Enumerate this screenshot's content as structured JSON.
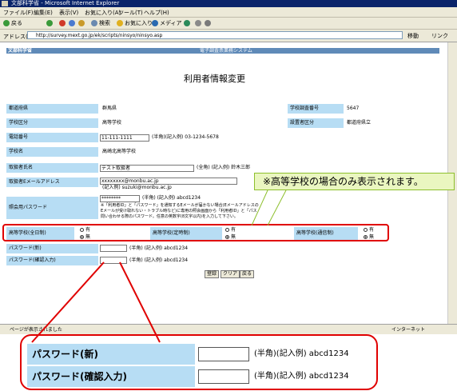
{
  "window": {
    "title": "文部科学省 - Microsoft Internet Explorer"
  },
  "menu": [
    "ファイル(F)",
    "編集(E)",
    "表示(V)",
    "お気に入り(A)",
    "ツール(T)",
    "ヘルプ(H)"
  ],
  "toolbar": {
    "back": "戻る",
    "search": "検索",
    "favorites": "お気に入り",
    "media": "メディア"
  },
  "address": {
    "label": "アドレス(D)",
    "url": "http://survey.mext.go.jp/ek/scripts/ninsyo/ninsyo.asp",
    "go": "移動",
    "links": "リンク"
  },
  "header": {
    "ministry": "文部科学省",
    "system": "電子調査票業務システム"
  },
  "page_title": "利用者情報変更",
  "form": {
    "pref_label": "都道府県",
    "pref_value": "群馬県",
    "school_no_label": "学校調査番号",
    "school_no_value": "5647",
    "school_type_label": "学校区分",
    "school_type_value": "高等学校",
    "founder_label": "設置者区分",
    "founder_value": "都道府県立",
    "phone_label": "電話番号",
    "phone_value": "11-111-1111",
    "phone_hint": "(半角)(記入例) 03-1234-5678",
    "school_name_label": "学校名",
    "school_name_value": "高崎北高等学校",
    "person_label": "取扱者氏名",
    "person_value": "テスト取扱者",
    "person_hint": "(全角) (記入例) 鈴木三郎",
    "email_label": "取扱者Eメールアドレス",
    "email_value": "xxxxxxxx@monbu.ac.jp",
    "email_hint": "(記入例) suzuki@monbu.ac.jp",
    "pw_label": "照会用パスワード",
    "pw_value": "********",
    "pw_hint": "(半角) (記入例) abcd1234",
    "pw_note1": "※「利用者ID」と「パスワード」を通知するEメールが届かない場合(Eメールアドレスの",
    "pw_note2": "Eメールが受け取れない・トラブル時など)に専用の照会画面から「利用者ID」と「パス",
    "pw_note3": "問い合わせる際のパスワード。任意の英数字(8文字以内)を入力して下さい。",
    "hs_full_label": "高等学校(全日制)",
    "hs_part_label": "高等学校(定時制)",
    "hs_corr_label": "高等学校(通信制)",
    "opt_yes": "有",
    "opt_no": "無",
    "newpw_label": "パスワード(新)",
    "newpw_hint": "(半角) (記入例) abcd1234",
    "confirmpw_label": "パスワード(確認入力)",
    "confirmpw_hint": "(半角) (記入例) abcd1234"
  },
  "buttons": {
    "register": "登録",
    "clear": "クリア",
    "back": "戻る"
  },
  "callout": "※高等学校の場合のみ表示されます。",
  "status": {
    "left": "ページが表示されました",
    "zone": "インターネット"
  },
  "zoom": {
    "newpw_label": "パスワード(新)",
    "newpw_hint": "(半角)(記入例) abcd1234",
    "confirmpw_label": "パスワード(確認入力)",
    "confirmpw_hint": "(半角)(記入例) abcd1234"
  }
}
